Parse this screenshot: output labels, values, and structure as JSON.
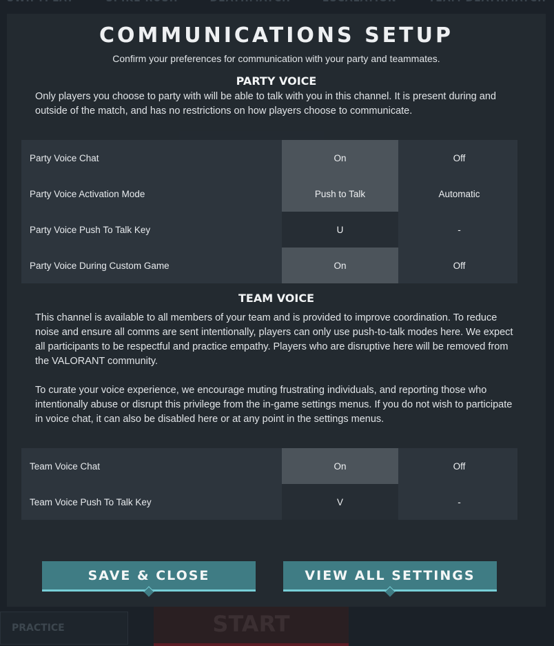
{
  "background": {
    "tabs": [
      "SWIFTPLAY",
      "SPIKE RUSH",
      "DEATHMATCH",
      "ESCALATION",
      "TEAM DEATHMATCH"
    ],
    "practice_label": "PRACTICE",
    "start_label": "START"
  },
  "modal": {
    "title": "COMMUNICATIONS SETUP",
    "subtitle": "Confirm your preferences for communication with your party and teammates."
  },
  "party_voice": {
    "heading": "PARTY VOICE",
    "description": "Only players you choose to party with will be able to talk with you in this channel. It is present during and outside of the match, and has no restrictions on how players choose to communicate.",
    "rows": [
      {
        "label": "Party Voice Chat",
        "option_a": "On",
        "option_b": "Off"
      },
      {
        "label": "Party Voice Activation Mode",
        "option_a": "Push to Talk",
        "option_b": "Automatic"
      },
      {
        "label": "Party Voice Push To Talk Key",
        "option_a": "U",
        "option_b": "-"
      },
      {
        "label": "Party Voice During Custom Game",
        "option_a": "On",
        "option_b": "Off"
      }
    ]
  },
  "team_voice": {
    "heading": "TEAM VOICE",
    "description_1": "This channel is available to all members of your team and is provided to improve coordination. To reduce noise and ensure all comms are sent intentionally, players can only use push-to-talk modes here. We expect all participants to be respectful and practice empathy.  Players who are disruptive here will be removed from the VALORANT community.",
    "description_2": "To curate your voice experience, we encourage muting frustrating individuals, and reporting those who intentionally abuse or disrupt this privilege from the in-game settings menus. If you do not wish to participate in voice chat, it can also be disabled here or at any point in the settings menus.",
    "rows": [
      {
        "label": "Team Voice Chat",
        "option_a": "On",
        "option_b": "Off"
      },
      {
        "label": "Team Voice Push To Talk Key",
        "option_a": "V",
        "option_b": "-"
      }
    ]
  },
  "buttons": {
    "save_close": "SAVE & CLOSE",
    "view_all": "VIEW ALL SETTINGS"
  },
  "colors": {
    "accent": "#3f7c84",
    "accent_underline": "#77cfd7",
    "selected_option": "#4c545b"
  }
}
